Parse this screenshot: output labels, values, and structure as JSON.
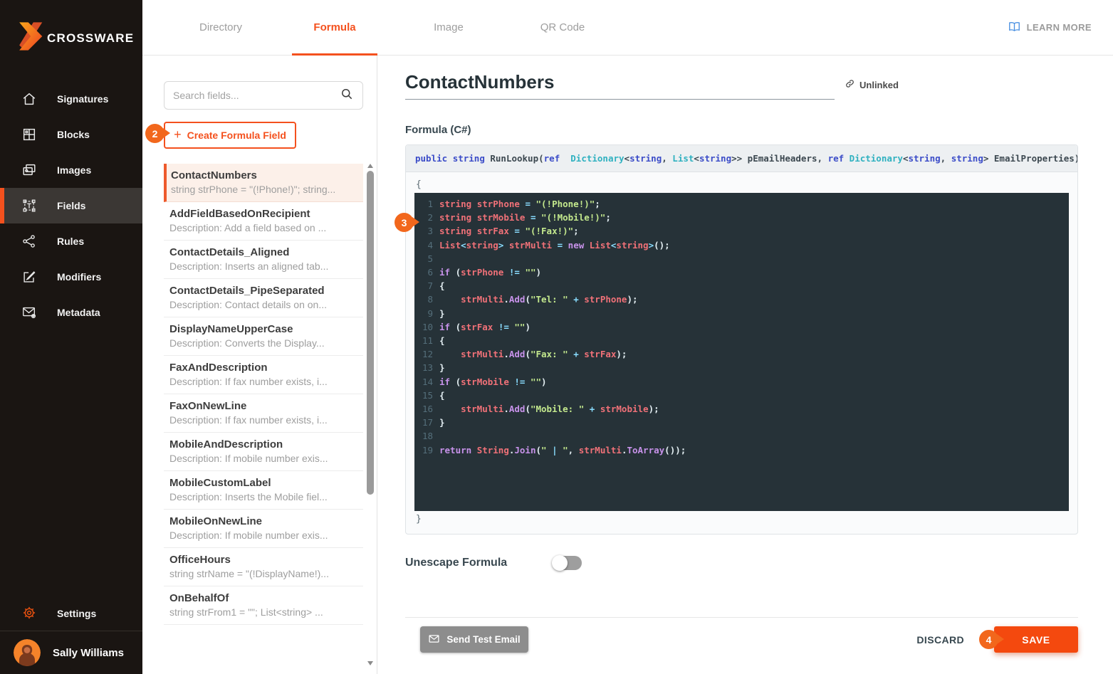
{
  "sidebar": {
    "brand": "CROSSWARE",
    "nav_items": [
      {
        "label": "Signatures",
        "icon": "home-icon",
        "active": false
      },
      {
        "label": "Blocks",
        "icon": "blocks-icon",
        "active": false
      },
      {
        "label": "Images",
        "icon": "images-icon",
        "active": false
      },
      {
        "label": "Fields",
        "icon": "fields-icon",
        "active": true
      },
      {
        "label": "Rules",
        "icon": "rules-icon",
        "active": false
      },
      {
        "label": "Modifiers",
        "icon": "modifiers-icon",
        "active": false
      },
      {
        "label": "Metadata",
        "icon": "metadata-icon",
        "active": false
      }
    ],
    "settings_label": "Settings",
    "user_name": "Sally Williams"
  },
  "topbar": {
    "tabs": [
      {
        "label": "Directory",
        "active": false
      },
      {
        "label": "Formula",
        "active": true
      },
      {
        "label": "Image",
        "active": false
      },
      {
        "label": "QR Code",
        "active": false
      }
    ],
    "learn_more_label": "LEARN MORE"
  },
  "fields_panel": {
    "search_placeholder": "Search fields...",
    "create_button": {
      "plus": "+",
      "label": "Create Formula Field"
    },
    "items": [
      {
        "name": "ContactNumbers",
        "description": "string strPhone = \"(!Phone!)\"; string...",
        "selected": true
      },
      {
        "name": "AddFieldBasedOnRecipient",
        "description": "Description: Add a field based on ...",
        "selected": false
      },
      {
        "name": "ContactDetails_Aligned",
        "description": "Description: Inserts an aligned tab...",
        "selected": false
      },
      {
        "name": "ContactDetails_PipeSeparated",
        "description": "Description: Contact details on on...",
        "selected": false
      },
      {
        "name": "DisplayNameUpperCase",
        "description": "Description: Converts the Display...",
        "selected": false
      },
      {
        "name": "FaxAndDescription",
        "description": "Description: If fax number exists, i...",
        "selected": false
      },
      {
        "name": "FaxOnNewLine",
        "description": "Description: If fax number exists, i...",
        "selected": false
      },
      {
        "name": "MobileAndDescription",
        "description": "Description: If mobile number exis...",
        "selected": false
      },
      {
        "name": "MobileCustomLabel",
        "description": "Description: Inserts the Mobile fiel...",
        "selected": false
      },
      {
        "name": "MobileOnNewLine",
        "description": "Description: If mobile number exis...",
        "selected": false
      },
      {
        "name": "OfficeHours",
        "description": "string strName = \"(!DisplayName!)...",
        "selected": false
      },
      {
        "name": "OnBehalfOf",
        "description": "string strFrom1 = \"\"; List<string> ...",
        "selected": false
      }
    ]
  },
  "editor": {
    "title": "ContactNumbers",
    "unlinked_label": "Unlinked",
    "formula_label": "Formula (C#)",
    "signature_tokens": [
      [
        "b",
        "public"
      ],
      [
        "pl",
        " "
      ],
      [
        "b",
        "string"
      ],
      [
        "pl",
        " RunLookup("
      ],
      [
        "b",
        "ref"
      ],
      [
        "pl",
        "  "
      ],
      [
        "t",
        "Dictionary"
      ],
      [
        "pl",
        "<"
      ],
      [
        "b",
        "string"
      ],
      [
        "pl",
        ", "
      ],
      [
        "t",
        "List"
      ],
      [
        "pl",
        "<"
      ],
      [
        "b",
        "string"
      ],
      [
        "pl",
        ">> pEmailHeaders, "
      ],
      [
        "b",
        "ref"
      ],
      [
        "pl",
        " "
      ],
      [
        "t",
        "Dictionary"
      ],
      [
        "pl",
        "<"
      ],
      [
        "b",
        "string"
      ],
      [
        "pl",
        ", "
      ],
      [
        "b",
        "string"
      ],
      [
        "pl",
        "> EmailProperties)"
      ]
    ],
    "open_brace": "{",
    "close_brace": "}",
    "code_lines": [
      {
        "n": "1",
        "tokens": [
          [
            "v",
            "string"
          ],
          [
            "p",
            " "
          ],
          [
            "v",
            "strPhone"
          ],
          [
            "p",
            " "
          ],
          [
            "o",
            "="
          ],
          [
            "p",
            " "
          ],
          [
            "s",
            "\"(!Phone!)\""
          ],
          [
            "p",
            ";"
          ]
        ]
      },
      {
        "n": "2",
        "tokens": [
          [
            "v",
            "string"
          ],
          [
            "p",
            " "
          ],
          [
            "v",
            "strMobile"
          ],
          [
            "p",
            " "
          ],
          [
            "o",
            "="
          ],
          [
            "p",
            " "
          ],
          [
            "s",
            "\"(!Mobile!)\""
          ],
          [
            "p",
            ";"
          ]
        ]
      },
      {
        "n": "3",
        "tokens": [
          [
            "v",
            "string"
          ],
          [
            "p",
            " "
          ],
          [
            "v",
            "strFax"
          ],
          [
            "p",
            " "
          ],
          [
            "o",
            "="
          ],
          [
            "p",
            " "
          ],
          [
            "s",
            "\"(!Fax!)\""
          ],
          [
            "p",
            ";"
          ]
        ]
      },
      {
        "n": "4",
        "tokens": [
          [
            "v",
            "List"
          ],
          [
            "o",
            "<"
          ],
          [
            "v",
            "string"
          ],
          [
            "o",
            ">"
          ],
          [
            "p",
            " "
          ],
          [
            "v",
            "strMulti"
          ],
          [
            "p",
            " "
          ],
          [
            "o",
            "="
          ],
          [
            "p",
            " "
          ],
          [
            "k",
            "new"
          ],
          [
            "p",
            " "
          ],
          [
            "v",
            "List"
          ],
          [
            "o",
            "<"
          ],
          [
            "v",
            "string"
          ],
          [
            "o",
            ">"
          ],
          [
            "p",
            "();"
          ]
        ]
      },
      {
        "n": "5",
        "tokens": []
      },
      {
        "n": "6",
        "tokens": [
          [
            "k",
            "if"
          ],
          [
            "p",
            " ("
          ],
          [
            "v",
            "strPhone"
          ],
          [
            "p",
            " "
          ],
          [
            "o",
            "!="
          ],
          [
            "p",
            " "
          ],
          [
            "s",
            "\"\""
          ],
          [
            "p",
            ")"
          ]
        ]
      },
      {
        "n": "7",
        "tokens": [
          [
            "p",
            "{"
          ]
        ]
      },
      {
        "n": "8",
        "tokens": [
          [
            "p",
            "    "
          ],
          [
            "v",
            "strMulti"
          ],
          [
            "p",
            "."
          ],
          [
            "k",
            "Add"
          ],
          [
            "p",
            "("
          ],
          [
            "s",
            "\"Tel: \""
          ],
          [
            "p",
            " "
          ],
          [
            "o",
            "+"
          ],
          [
            "p",
            " "
          ],
          [
            "v",
            "strPhone"
          ],
          [
            "p",
            ");"
          ]
        ]
      },
      {
        "n": "9",
        "tokens": [
          [
            "p",
            "}"
          ]
        ]
      },
      {
        "n": "10",
        "tokens": [
          [
            "k",
            "if"
          ],
          [
            "p",
            " ("
          ],
          [
            "v",
            "strFax"
          ],
          [
            "p",
            " "
          ],
          [
            "o",
            "!="
          ],
          [
            "p",
            " "
          ],
          [
            "s",
            "\"\""
          ],
          [
            "p",
            ")"
          ]
        ]
      },
      {
        "n": "11",
        "tokens": [
          [
            "p",
            "{"
          ]
        ]
      },
      {
        "n": "12",
        "tokens": [
          [
            "p",
            "    "
          ],
          [
            "v",
            "strMulti"
          ],
          [
            "p",
            "."
          ],
          [
            "k",
            "Add"
          ],
          [
            "p",
            "("
          ],
          [
            "s",
            "\"Fax: \""
          ],
          [
            "p",
            " "
          ],
          [
            "o",
            "+"
          ],
          [
            "p",
            " "
          ],
          [
            "v",
            "strFax"
          ],
          [
            "p",
            ");"
          ]
        ]
      },
      {
        "n": "13",
        "tokens": [
          [
            "p",
            "}"
          ]
        ]
      },
      {
        "n": "14",
        "tokens": [
          [
            "k",
            "if"
          ],
          [
            "p",
            " ("
          ],
          [
            "v",
            "strMobile"
          ],
          [
            "p",
            " "
          ],
          [
            "o",
            "!="
          ],
          [
            "p",
            " "
          ],
          [
            "s",
            "\"\""
          ],
          [
            "p",
            ")"
          ]
        ]
      },
      {
        "n": "15",
        "tokens": [
          [
            "p",
            "{"
          ]
        ]
      },
      {
        "n": "16",
        "tokens": [
          [
            "p",
            "    "
          ],
          [
            "v",
            "strMulti"
          ],
          [
            "p",
            "."
          ],
          [
            "k",
            "Add"
          ],
          [
            "p",
            "("
          ],
          [
            "s",
            "\"Mobile: \""
          ],
          [
            "p",
            " "
          ],
          [
            "o",
            "+"
          ],
          [
            "p",
            " "
          ],
          [
            "v",
            "strMobile"
          ],
          [
            "p",
            ");"
          ]
        ]
      },
      {
        "n": "17",
        "tokens": [
          [
            "p",
            "}"
          ]
        ]
      },
      {
        "n": "18",
        "tokens": []
      },
      {
        "n": "19",
        "tokens": [
          [
            "k",
            "return"
          ],
          [
            "p",
            " "
          ],
          [
            "v",
            "String"
          ],
          [
            "p",
            "."
          ],
          [
            "k",
            "Join"
          ],
          [
            "p",
            "("
          ],
          [
            "s",
            "\" "
          ],
          [
            "o",
            "|"
          ],
          [
            "s",
            " \""
          ],
          [
            "p",
            ", "
          ],
          [
            "v",
            "strMulti"
          ],
          [
            "p",
            "."
          ],
          [
            "k",
            "ToArray"
          ],
          [
            "p",
            "());"
          ]
        ]
      }
    ],
    "unescape_label": "Unescape Formula",
    "unescape_enabled": false
  },
  "footer": {
    "send_test_label": "Send Test Email",
    "discard_label": "DISCARD",
    "save_label": "SAVE"
  },
  "annotations": {
    "markers": [
      {
        "number": "2"
      },
      {
        "number": "3"
      },
      {
        "number": "4"
      }
    ]
  },
  "colors": {
    "accent_orange": "#f4511e",
    "save_orange": "#f4490e",
    "marker_orange": "#f2671c",
    "sidebar_bg": "#1a1512",
    "selected_item_bg": "#fcf0e9",
    "code_bg": "#263238",
    "code_keyword": "#c792ea",
    "code_variable": "#f07178",
    "code_string": "#c3e88d",
    "code_operator": "#89ddff",
    "code_linenumber": "#546e7a",
    "learn_more_blue": "#4a90e2"
  }
}
